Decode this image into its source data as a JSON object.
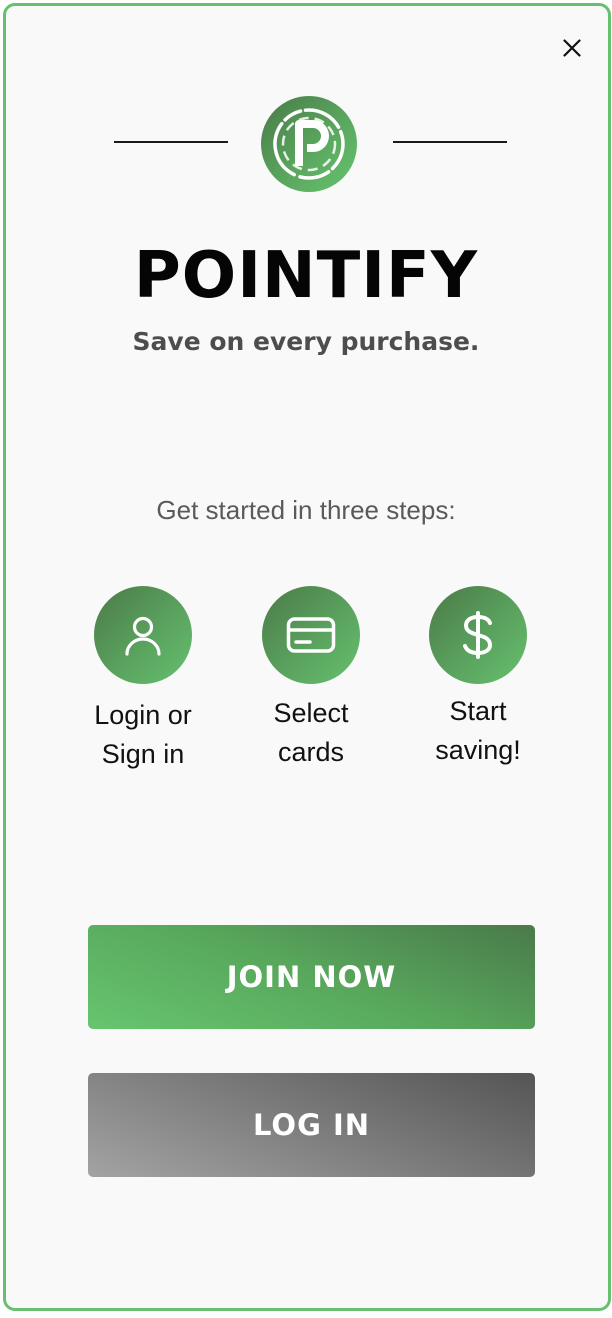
{
  "brand": {
    "name": "POINTIFY",
    "tagline": "Save on every purchase.",
    "logo_icon": "pointify-p-badge-icon"
  },
  "steps_heading": "Get started in three steps:",
  "steps": [
    {
      "icon": "user-icon",
      "label": "Login or\nSign in"
    },
    {
      "icon": "credit-card-icon",
      "label": "Select\ncards"
    },
    {
      "icon": "dollar-icon",
      "label": "Start\nsaving!"
    }
  ],
  "buttons": {
    "join_label": "JOIN NOW",
    "login_label": "LOG IN"
  },
  "close_icon": "close-icon",
  "colors": {
    "accent_green": "#66c06f",
    "dark_green": "#4b7a48",
    "gray_button": "#7c7c7c"
  }
}
